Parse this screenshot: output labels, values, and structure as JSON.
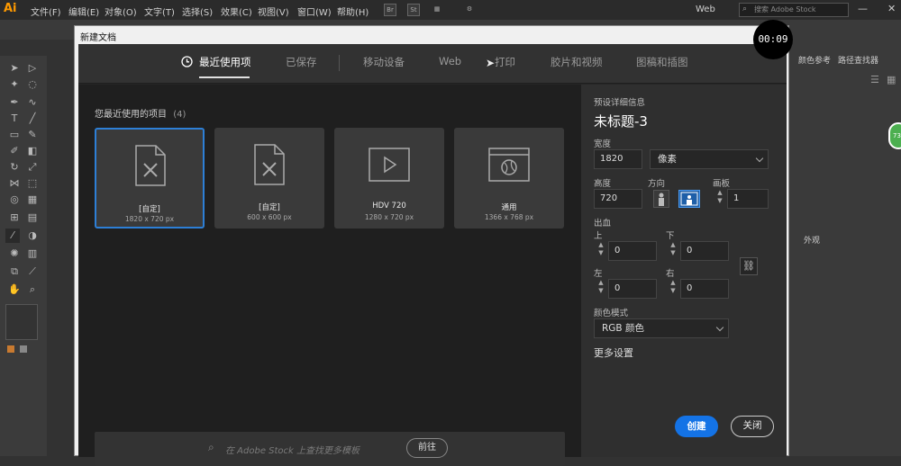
{
  "menubar": {
    "logo": "Ai",
    "items": [
      "文件(F)",
      "编辑(E)",
      "对象(O)",
      "文字(T)",
      "选择(S)",
      "效果(C)",
      "视图(V)",
      "窗口(W)",
      "帮助(H)"
    ],
    "bridge": "Br",
    "stock": "St",
    "workspace": "Web",
    "search_placeholder": "搜索 Adobe Stock"
  },
  "right_panel": {
    "tabs": [
      "颜色参考",
      "路径查找器"
    ],
    "appearance_tab": "外观",
    "badge": "73"
  },
  "timer": "00:09",
  "dialog": {
    "title": "新建文档",
    "tabs": [
      {
        "label": "最近使用项",
        "active": true
      },
      {
        "label": "已保存"
      },
      {
        "label": "移动设备"
      },
      {
        "label": "Web"
      },
      {
        "label": "打印"
      },
      {
        "label": "胶片和视频"
      },
      {
        "label": "图稿和插图"
      }
    ],
    "recent_title": "您最近使用的项目",
    "recent_count": "(4)",
    "presets": [
      {
        "name": "[自定]",
        "size": "1820 x 720 px",
        "icon": "custom-document-icon",
        "selected": true
      },
      {
        "name": "[自定]",
        "size": "600 x 600 px",
        "icon": "custom-document-icon"
      },
      {
        "name": "HDV 720",
        "size": "1280 x 720 px",
        "icon": "video-play-icon"
      },
      {
        "name": "通用",
        "size": "1366 x 768 px",
        "icon": "web-browser-icon"
      }
    ],
    "stock_placeholder": "在 Adobe Stock 上查找更多模板",
    "go_label": "前往",
    "details": {
      "section_title": "预设详细信息",
      "doc_name": "未标题-3",
      "width_label": "宽度",
      "width_value": "1820",
      "unit_value": "像素",
      "height_label": "高度",
      "height_value": "720",
      "orientation_label": "方向",
      "artboards_label": "画板",
      "artboards_value": "1",
      "bleed_label": "出血",
      "top_label": "上",
      "top_value": "0",
      "bottom_label": "下",
      "bottom_value": "0",
      "left_label": "左",
      "left_value": "0",
      "right_label": "右",
      "right_value": "0",
      "color_mode_label": "颜色模式",
      "color_mode_value": "RGB 颜色",
      "more_settings": "更多设置",
      "create_label": "创建",
      "close_label": "关闭"
    }
  }
}
